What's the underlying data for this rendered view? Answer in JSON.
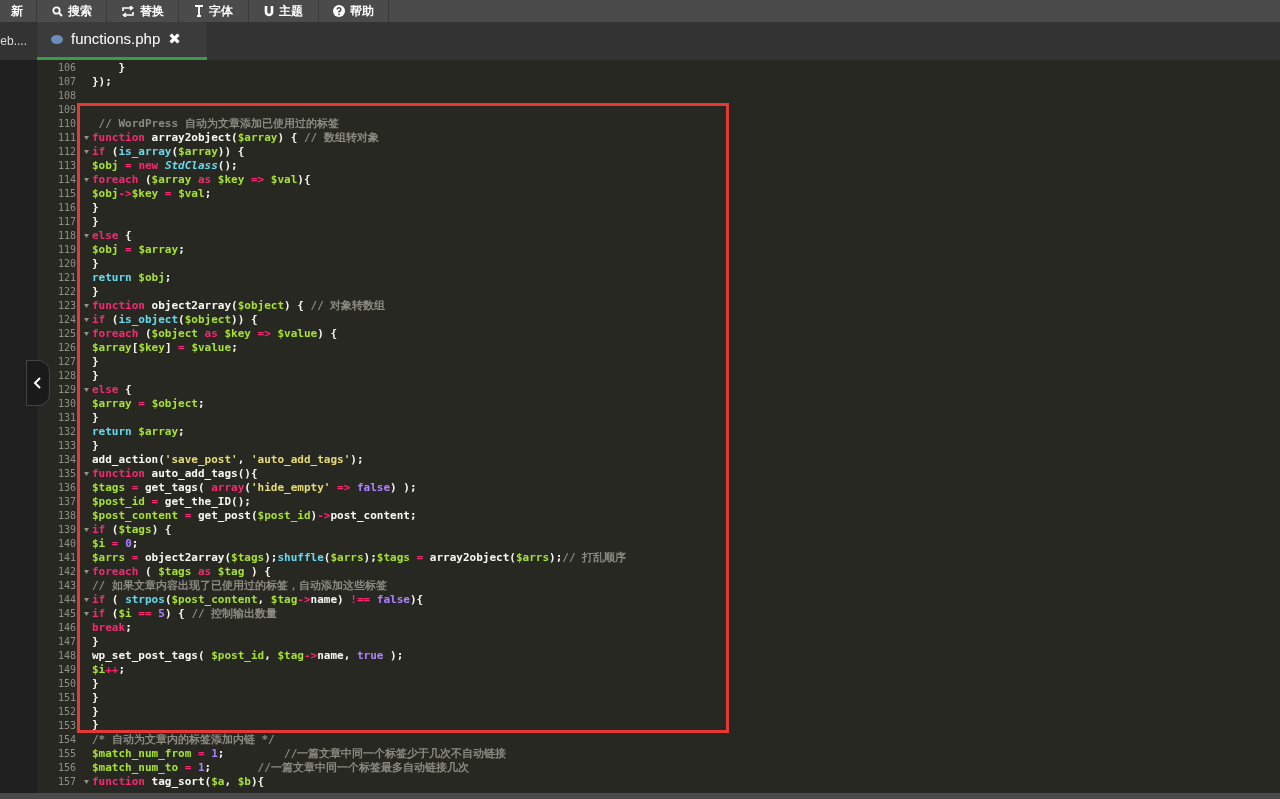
{
  "toolbar": {
    "buttons": [
      {
        "kind": "refresh",
        "label": "新"
      },
      {
        "kind": "search",
        "label": "搜索"
      },
      {
        "kind": "replace",
        "label": "替换"
      },
      {
        "kind": "font",
        "label": "字体"
      },
      {
        "kind": "theme",
        "label": "主题"
      },
      {
        "kind": "help",
        "label": "帮助"
      }
    ]
  },
  "tabs": [
    {
      "label": "eb....",
      "selected": false,
      "closable": false
    },
    {
      "label": "functions.php",
      "selected": true,
      "closable": true,
      "close": "✖"
    }
  ],
  "editor": {
    "lines": [
      {
        "number": "106",
        "foldable": false,
        "framed": false,
        "tokens": [
          {
            "kind": "plain",
            "text": "    }"
          }
        ]
      },
      {
        "number": "107",
        "foldable": false,
        "framed": false,
        "tokens": [
          {
            "kind": "plain",
            "text": "});"
          }
        ]
      },
      {
        "number": "108",
        "foldable": false,
        "framed": false
      },
      {
        "number": "109",
        "foldable": false,
        "framed": true
      },
      {
        "number": "110",
        "foldable": false,
        "framed": true,
        "tokens": [
          {
            "kind": "comment",
            "text": " // WordPress 自动为文章添加已使用过的标签"
          }
        ]
      },
      {
        "number": "111",
        "foldable": true,
        "framed": true,
        "tokens": [
          {
            "kind": "keyword",
            "text": "function"
          },
          {
            "kind": "plain",
            "text": " array2object("
          },
          {
            "kind": "variable",
            "text": "$array"
          },
          {
            "kind": "plain",
            "text": ") { "
          },
          {
            "kind": "comment",
            "text": "// 数组转对象"
          }
        ]
      },
      {
        "number": "112",
        "foldable": true,
        "framed": true,
        "tokens": [
          {
            "kind": "keyword",
            "text": "if"
          },
          {
            "kind": "plain",
            "text": " ("
          },
          {
            "kind": "builtin",
            "text": "is_array"
          },
          {
            "kind": "plain",
            "text": "("
          },
          {
            "kind": "variable",
            "text": "$array"
          },
          {
            "kind": "plain",
            "text": ")) {"
          }
        ]
      },
      {
        "number": "113",
        "foldable": false,
        "framed": true,
        "tokens": [
          {
            "kind": "variable",
            "text": "$obj"
          },
          {
            "kind": "operator",
            "text": " = "
          },
          {
            "kind": "keyword",
            "text": "new "
          },
          {
            "kind": "class",
            "text": "StdClass"
          },
          {
            "kind": "plain",
            "text": "();"
          }
        ]
      },
      {
        "number": "114",
        "foldable": true,
        "framed": true,
        "tokens": [
          {
            "kind": "keyword",
            "text": "foreach"
          },
          {
            "kind": "plain",
            "text": " ("
          },
          {
            "kind": "variable",
            "text": "$array"
          },
          {
            "kind": "keyword",
            "text": " as "
          },
          {
            "kind": "variable",
            "text": "$key"
          },
          {
            "kind": "operator",
            "text": " => "
          },
          {
            "kind": "variable",
            "text": "$val"
          },
          {
            "kind": "plain",
            "text": "){"
          }
        ]
      },
      {
        "number": "115",
        "foldable": false,
        "framed": true,
        "tokens": [
          {
            "kind": "variable",
            "text": "$obj"
          },
          {
            "kind": "operator",
            "text": "->"
          },
          {
            "kind": "variable",
            "text": "$key"
          },
          {
            "kind": "operator",
            "text": " = "
          },
          {
            "kind": "variable",
            "text": "$val"
          },
          {
            "kind": "plain",
            "text": ";"
          }
        ]
      },
      {
        "number": "116",
        "foldable": false,
        "framed": true,
        "tokens": [
          {
            "kind": "plain",
            "text": "}"
          }
        ]
      },
      {
        "number": "117",
        "foldable": false,
        "framed": true,
        "tokens": [
          {
            "kind": "plain",
            "text": "}"
          }
        ]
      },
      {
        "number": "118",
        "foldable": true,
        "framed": true,
        "tokens": [
          {
            "kind": "keyword",
            "text": "else"
          },
          {
            "kind": "plain",
            "text": " {"
          }
        ]
      },
      {
        "number": "119",
        "foldable": false,
        "framed": true,
        "tokens": [
          {
            "kind": "variable",
            "text": "$obj"
          },
          {
            "kind": "operator",
            "text": " = "
          },
          {
            "kind": "variable",
            "text": "$array"
          },
          {
            "kind": "plain",
            "text": ";"
          }
        ]
      },
      {
        "number": "120",
        "foldable": false,
        "framed": true,
        "tokens": [
          {
            "kind": "plain",
            "text": "}"
          }
        ]
      },
      {
        "number": "121",
        "foldable": false,
        "framed": true,
        "tokens": [
          {
            "kind": "builtin",
            "text": "return "
          },
          {
            "kind": "variable",
            "text": "$obj"
          },
          {
            "kind": "plain",
            "text": ";"
          }
        ]
      },
      {
        "number": "122",
        "foldable": false,
        "framed": true,
        "tokens": [
          {
            "kind": "plain",
            "text": "}"
          }
        ]
      },
      {
        "number": "123",
        "foldable": true,
        "framed": true,
        "tokens": [
          {
            "kind": "keyword",
            "text": "function"
          },
          {
            "kind": "plain",
            "text": " object2array("
          },
          {
            "kind": "variable",
            "text": "$object"
          },
          {
            "kind": "plain",
            "text": ") { "
          },
          {
            "kind": "comment",
            "text": "// 对象转数组"
          }
        ]
      },
      {
        "number": "124",
        "foldable": true,
        "framed": true,
        "tokens": [
          {
            "kind": "keyword",
            "text": "if"
          },
          {
            "kind": "plain",
            "text": " ("
          },
          {
            "kind": "builtin",
            "text": "is_object"
          },
          {
            "kind": "plain",
            "text": "("
          },
          {
            "kind": "variable",
            "text": "$object"
          },
          {
            "kind": "plain",
            "text": ")) {"
          }
        ]
      },
      {
        "number": "125",
        "foldable": true,
        "framed": true,
        "tokens": [
          {
            "kind": "keyword",
            "text": "foreach"
          },
          {
            "kind": "plain",
            "text": " ("
          },
          {
            "kind": "variable",
            "text": "$object"
          },
          {
            "kind": "keyword",
            "text": " as "
          },
          {
            "kind": "variable",
            "text": "$key"
          },
          {
            "kind": "operator",
            "text": " => "
          },
          {
            "kind": "variable",
            "text": "$value"
          },
          {
            "kind": "plain",
            "text": ") {"
          }
        ]
      },
      {
        "number": "126",
        "foldable": false,
        "framed": true,
        "tokens": [
          {
            "kind": "variable",
            "text": "$array"
          },
          {
            "kind": "plain",
            "text": "["
          },
          {
            "kind": "variable",
            "text": "$key"
          },
          {
            "kind": "plain",
            "text": "]"
          },
          {
            "kind": "operator",
            "text": " = "
          },
          {
            "kind": "variable",
            "text": "$value"
          },
          {
            "kind": "plain",
            "text": ";"
          }
        ]
      },
      {
        "number": "127",
        "foldable": false,
        "framed": true,
        "tokens": [
          {
            "kind": "plain",
            "text": "}"
          }
        ]
      },
      {
        "number": "128",
        "foldable": false,
        "framed": true,
        "tokens": [
          {
            "kind": "plain",
            "text": "}"
          }
        ]
      },
      {
        "number": "129",
        "foldable": true,
        "framed": true,
        "tokens": [
          {
            "kind": "keyword",
            "text": "else"
          },
          {
            "kind": "plain",
            "text": " {"
          }
        ]
      },
      {
        "number": "130",
        "foldable": false,
        "framed": true,
        "tokens": [
          {
            "kind": "variable",
            "text": "$array"
          },
          {
            "kind": "operator",
            "text": " = "
          },
          {
            "kind": "variable",
            "text": "$object"
          },
          {
            "kind": "plain",
            "text": ";"
          }
        ]
      },
      {
        "number": "131",
        "foldable": false,
        "framed": true,
        "tokens": [
          {
            "kind": "plain",
            "text": "}"
          }
        ]
      },
      {
        "number": "132",
        "foldable": false,
        "framed": true,
        "tokens": [
          {
            "kind": "builtin",
            "text": "return "
          },
          {
            "kind": "variable",
            "text": "$array"
          },
          {
            "kind": "plain",
            "text": ";"
          }
        ]
      },
      {
        "number": "133",
        "foldable": false,
        "framed": true,
        "tokens": [
          {
            "kind": "plain",
            "text": "}"
          }
        ]
      },
      {
        "number": "134",
        "foldable": false,
        "framed": true,
        "tokens": [
          {
            "kind": "plain",
            "text": "add_action("
          },
          {
            "kind": "string",
            "text": "'save_post'"
          },
          {
            "kind": "plain",
            "text": ", "
          },
          {
            "kind": "string",
            "text": "'auto_add_tags'"
          },
          {
            "kind": "plain",
            "text": ");"
          }
        ]
      },
      {
        "number": "135",
        "foldable": true,
        "framed": true,
        "tokens": [
          {
            "kind": "keyword",
            "text": "function"
          },
          {
            "kind": "plain",
            "text": " auto_add_tags(){"
          }
        ]
      },
      {
        "number": "136",
        "foldable": false,
        "framed": true,
        "tokens": [
          {
            "kind": "variable",
            "text": "$tags"
          },
          {
            "kind": "operator",
            "text": " = "
          },
          {
            "kind": "plain",
            "text": "get_tags( "
          },
          {
            "kind": "keyword",
            "text": "array"
          },
          {
            "kind": "plain",
            "text": "("
          },
          {
            "kind": "string",
            "text": "'hide_empty'"
          },
          {
            "kind": "operator",
            "text": " => "
          },
          {
            "kind": "constant",
            "text": "false"
          },
          {
            "kind": "plain",
            "text": ") );"
          }
        ]
      },
      {
        "number": "137",
        "foldable": false,
        "framed": true,
        "tokens": [
          {
            "kind": "variable",
            "text": "$post_id"
          },
          {
            "kind": "operator",
            "text": " = "
          },
          {
            "kind": "plain",
            "text": "get_the_ID();"
          }
        ]
      },
      {
        "number": "138",
        "foldable": false,
        "framed": true,
        "tokens": [
          {
            "kind": "variable",
            "text": "$post_content"
          },
          {
            "kind": "operator",
            "text": " = "
          },
          {
            "kind": "plain",
            "text": "get_post("
          },
          {
            "kind": "variable",
            "text": "$post_id"
          },
          {
            "kind": "plain",
            "text": ")"
          },
          {
            "kind": "operator",
            "text": "->"
          },
          {
            "kind": "plain",
            "text": "post_content;"
          }
        ]
      },
      {
        "number": "139",
        "foldable": true,
        "framed": true,
        "tokens": [
          {
            "kind": "keyword",
            "text": "if"
          },
          {
            "kind": "plain",
            "text": " ("
          },
          {
            "kind": "variable",
            "text": "$tags"
          },
          {
            "kind": "plain",
            "text": ") {"
          }
        ]
      },
      {
        "number": "140",
        "foldable": false,
        "framed": true,
        "tokens": [
          {
            "kind": "variable",
            "text": "$i"
          },
          {
            "kind": "operator",
            "text": " = "
          },
          {
            "kind": "constant",
            "text": "0"
          },
          {
            "kind": "plain",
            "text": ";"
          }
        ]
      },
      {
        "number": "141",
        "foldable": false,
        "framed": true,
        "tokens": [
          {
            "kind": "variable",
            "text": "$arrs"
          },
          {
            "kind": "operator",
            "text": " = "
          },
          {
            "kind": "plain",
            "text": "object2array("
          },
          {
            "kind": "variable",
            "text": "$tags"
          },
          {
            "kind": "plain",
            "text": ");"
          },
          {
            "kind": "builtin",
            "text": "shuffle"
          },
          {
            "kind": "plain",
            "text": "("
          },
          {
            "kind": "variable",
            "text": "$arrs"
          },
          {
            "kind": "plain",
            "text": ");"
          },
          {
            "kind": "variable",
            "text": "$tags"
          },
          {
            "kind": "operator",
            "text": " = "
          },
          {
            "kind": "plain",
            "text": "array2object("
          },
          {
            "kind": "variable",
            "text": "$arrs"
          },
          {
            "kind": "plain",
            "text": ");"
          },
          {
            "kind": "comment",
            "text": "// 打乱顺序"
          }
        ]
      },
      {
        "number": "142",
        "foldable": true,
        "framed": true,
        "tokens": [
          {
            "kind": "keyword",
            "text": "foreach"
          },
          {
            "kind": "plain",
            "text": " ( "
          },
          {
            "kind": "variable",
            "text": "$tags"
          },
          {
            "kind": "keyword",
            "text": " as "
          },
          {
            "kind": "variable",
            "text": "$tag"
          },
          {
            "kind": "plain",
            "text": " ) {"
          }
        ]
      },
      {
        "number": "143",
        "foldable": false,
        "framed": true,
        "tokens": [
          {
            "kind": "comment",
            "text": "// 如果文章内容出现了已使用过的标签，自动添加这些标签"
          }
        ]
      },
      {
        "number": "144",
        "foldable": true,
        "framed": true,
        "tokens": [
          {
            "kind": "keyword",
            "text": "if"
          },
          {
            "kind": "plain",
            "text": " ( "
          },
          {
            "kind": "builtin",
            "text": "strpos"
          },
          {
            "kind": "plain",
            "text": "("
          },
          {
            "kind": "variable",
            "text": "$post_content"
          },
          {
            "kind": "plain",
            "text": ", "
          },
          {
            "kind": "variable",
            "text": "$tag"
          },
          {
            "kind": "operator",
            "text": "->"
          },
          {
            "kind": "plain",
            "text": "name)"
          },
          {
            "kind": "operator",
            "text": " !== "
          },
          {
            "kind": "constant",
            "text": "false"
          },
          {
            "kind": "plain",
            "text": "){"
          }
        ]
      },
      {
        "number": "145",
        "foldable": true,
        "framed": true,
        "tokens": [
          {
            "kind": "keyword",
            "text": "if"
          },
          {
            "kind": "plain",
            "text": " ("
          },
          {
            "kind": "variable",
            "text": "$i"
          },
          {
            "kind": "operator",
            "text": " == "
          },
          {
            "kind": "constant",
            "text": "5"
          },
          {
            "kind": "plain",
            "text": ") { "
          },
          {
            "kind": "comment",
            "text": "// 控制输出数量"
          }
        ]
      },
      {
        "number": "146",
        "foldable": false,
        "framed": true,
        "tokens": [
          {
            "kind": "keyword",
            "text": "break"
          },
          {
            "kind": "plain",
            "text": ";"
          }
        ]
      },
      {
        "number": "147",
        "foldable": false,
        "framed": true,
        "tokens": [
          {
            "kind": "plain",
            "text": "}"
          }
        ]
      },
      {
        "number": "148",
        "foldable": false,
        "framed": true,
        "tokens": [
          {
            "kind": "plain",
            "text": "wp_set_post_tags( "
          },
          {
            "kind": "variable",
            "text": "$post_id"
          },
          {
            "kind": "plain",
            "text": ", "
          },
          {
            "kind": "variable",
            "text": "$tag"
          },
          {
            "kind": "operator",
            "text": "->"
          },
          {
            "kind": "plain",
            "text": "name, "
          },
          {
            "kind": "constant",
            "text": "true"
          },
          {
            "kind": "plain",
            "text": " );"
          }
        ]
      },
      {
        "number": "149",
        "foldable": false,
        "framed": true,
        "tokens": [
          {
            "kind": "variable",
            "text": "$i"
          },
          {
            "kind": "operator",
            "text": "++"
          },
          {
            "kind": "plain",
            "text": ";"
          }
        ]
      },
      {
        "number": "150",
        "foldable": false,
        "framed": true,
        "tokens": [
          {
            "kind": "plain",
            "text": "}"
          }
        ]
      },
      {
        "number": "151",
        "foldable": false,
        "framed": true,
        "tokens": [
          {
            "kind": "plain",
            "text": "}"
          }
        ]
      },
      {
        "number": "152",
        "foldable": false,
        "framed": true,
        "tokens": [
          {
            "kind": "plain",
            "text": "}"
          }
        ]
      },
      {
        "number": "153",
        "foldable": false,
        "framed": true,
        "tokens": [
          {
            "kind": "plain",
            "text": "}"
          }
        ]
      },
      {
        "number": "154",
        "foldable": false,
        "framed": false,
        "tokens": [
          {
            "kind": "comment",
            "text": "/* 自动为文章内的标签添加内链 */"
          }
        ]
      },
      {
        "number": "155",
        "foldable": false,
        "framed": false,
        "tokens": [
          {
            "kind": "variable",
            "text": "$match_num_from"
          },
          {
            "kind": "operator",
            "text": " = "
          },
          {
            "kind": "constant",
            "text": "1"
          },
          {
            "kind": "plain",
            "text": ";         "
          },
          {
            "kind": "comment",
            "text": "//一篇文章中同一个标签少于几次不自动链接"
          }
        ]
      },
      {
        "number": "156",
        "foldable": false,
        "framed": false,
        "tokens": [
          {
            "kind": "variable",
            "text": "$match_num_to"
          },
          {
            "kind": "operator",
            "text": " = "
          },
          {
            "kind": "constant",
            "text": "1"
          },
          {
            "kind": "plain",
            "text": ";       "
          },
          {
            "kind": "comment",
            "text": "//一篇文章中同一个标签最多自动链接几次"
          }
        ]
      },
      {
        "number": "157",
        "foldable": true,
        "framed": false,
        "tokens": [
          {
            "kind": "keyword",
            "text": "function"
          },
          {
            "kind": "plain",
            "text": " tag_sort("
          },
          {
            "kind": "variable",
            "text": "$a"
          },
          {
            "kind": "plain",
            "text": ", "
          },
          {
            "kind": "variable",
            "text": "$b"
          },
          {
            "kind": "plain",
            "text": "){"
          }
        ]
      }
    ]
  }
}
